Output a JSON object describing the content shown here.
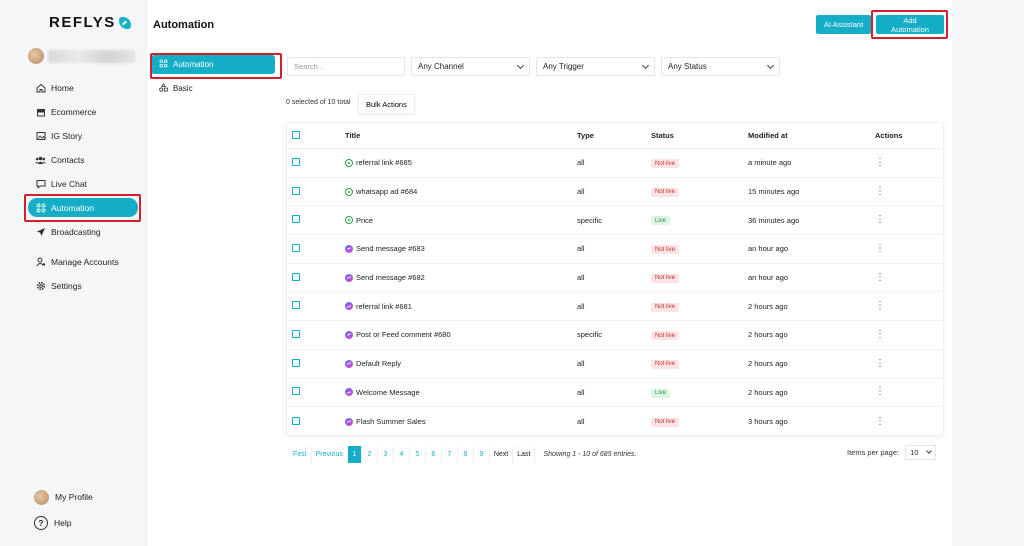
{
  "brand": {
    "name": "REFLYS",
    "accent": "#16aec7"
  },
  "sidebar": {
    "items": [
      {
        "label": "Home",
        "icon": "home-icon"
      },
      {
        "label": "Ecommerce",
        "icon": "store-icon"
      },
      {
        "label": "IG Story",
        "icon": "image-icon"
      },
      {
        "label": "Contacts",
        "icon": "users-icon"
      },
      {
        "label": "Live Chat",
        "icon": "chat-icon"
      },
      {
        "label": "Automation",
        "icon": "automation-icon",
        "active": true
      },
      {
        "label": "Broadcasting",
        "icon": "send-icon"
      },
      {
        "label": "Manage Accounts",
        "icon": "user-gear-icon"
      },
      {
        "label": "Settings",
        "icon": "gear-icon"
      }
    ],
    "bottom": {
      "profile_label": "My Profile",
      "help_label": "Help"
    }
  },
  "header": {
    "title": "Automation",
    "ai_button": "AI Assistant",
    "add_button": "Add Automation"
  },
  "subnav": {
    "items": [
      {
        "label": "Automation",
        "active": true
      },
      {
        "label": "Basic"
      }
    ]
  },
  "filters": {
    "search_placeholder": "Search...",
    "channel": "Any Channel",
    "trigger": "Any Trigger",
    "status": "Any Status"
  },
  "selection": {
    "info": "0 selected of 10 total",
    "bulk_label": "Bulk Actions"
  },
  "table": {
    "columns": [
      "Title",
      "Type",
      "Status",
      "Modified at",
      "Actions"
    ],
    "rows": [
      {
        "title": "referral link #685",
        "channel": "whatsapp",
        "type": "all",
        "status": "Not live",
        "modified": "a minute ago"
      },
      {
        "title": "whatsapp ad #684",
        "channel": "whatsapp",
        "type": "all",
        "status": "Not live",
        "modified": "15 minutes ago"
      },
      {
        "title": "Price",
        "channel": "whatsapp",
        "type": "specific",
        "status": "Live",
        "modified": "36 minutes ago"
      },
      {
        "title": "Send message #683",
        "channel": "messenger",
        "type": "all",
        "status": "Not live",
        "modified": "an hour ago"
      },
      {
        "title": "Send message #682",
        "channel": "messenger",
        "type": "all",
        "status": "Not live",
        "modified": "an hour ago"
      },
      {
        "title": "referral link #681",
        "channel": "messenger",
        "type": "all",
        "status": "Not live",
        "modified": "2 hours ago"
      },
      {
        "title": "Post or Feed comment #680",
        "channel": "messenger",
        "type": "specific",
        "status": "Not live",
        "modified": "2 hours ago"
      },
      {
        "title": "Default Reply",
        "channel": "messenger",
        "type": "all",
        "status": "Not live",
        "modified": "2 hours ago"
      },
      {
        "title": "Welcome Message",
        "channel": "messenger",
        "type": "all",
        "status": "Live",
        "modified": "2 hours ago"
      },
      {
        "title": "Flash Summer Sales",
        "channel": "messenger",
        "type": "all",
        "status": "Not live",
        "modified": "3 hours ago"
      }
    ]
  },
  "pagination": {
    "first": "First",
    "previous": "Previous",
    "pages": [
      "1",
      "2",
      "3",
      "4",
      "5",
      "6",
      "7",
      "8",
      "9"
    ],
    "current": "1",
    "next": "Next",
    "last": "Last",
    "entries": "Showing 1 - 10 of 685 entries.",
    "per_page_label": "Items per page:",
    "per_page": "10"
  }
}
